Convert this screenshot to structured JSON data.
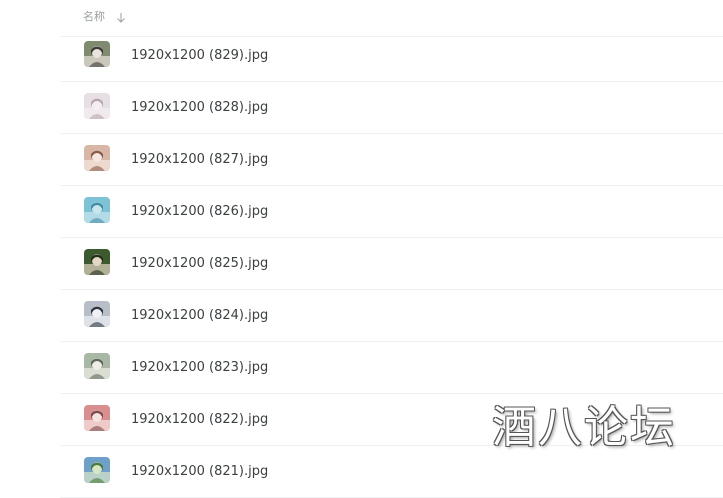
{
  "header": {
    "name_label": "名称",
    "sort_icon": "arrow-down-icon"
  },
  "files": [
    {
      "name": "1920x1200 (829).jpg",
      "thumb_colors": [
        "#7f8a6e",
        "#e9e3dc",
        "#3c3a36"
      ]
    },
    {
      "name": "1920x1200 (828).jpg",
      "thumb_colors": [
        "#e6dfe4",
        "#f4eef2",
        "#b9a6ad"
      ]
    },
    {
      "name": "1920x1200 (827).jpg",
      "thumb_colors": [
        "#d9b7a6",
        "#f5e7df",
        "#8a5a48"
      ]
    },
    {
      "name": "1920x1200 (826).jpg",
      "thumb_colors": [
        "#7ec2d6",
        "#c9e6ee",
        "#3f8ea4"
      ]
    },
    {
      "name": "1920x1200 (825).jpg",
      "thumb_colors": [
        "#3d5a2e",
        "#e4d6c6",
        "#1f2f18"
      ]
    },
    {
      "name": "1920x1200 (824).jpg",
      "thumb_colors": [
        "#b7bec8",
        "#eef0f3",
        "#2f3440"
      ]
    },
    {
      "name": "1920x1200 (823).jpg",
      "thumb_colors": [
        "#a9b8a4",
        "#f0ede6",
        "#5e6b5a"
      ]
    },
    {
      "name": "1920x1200 (822).jpg",
      "thumb_colors": [
        "#d98f8f",
        "#f6e3e0",
        "#7a4b4b"
      ]
    },
    {
      "name": "1920x1200 (821).jpg",
      "thumb_colors": [
        "#6fa0c9",
        "#d9e6c4",
        "#4a7a36"
      ]
    }
  ],
  "watermark": "酒八论坛"
}
